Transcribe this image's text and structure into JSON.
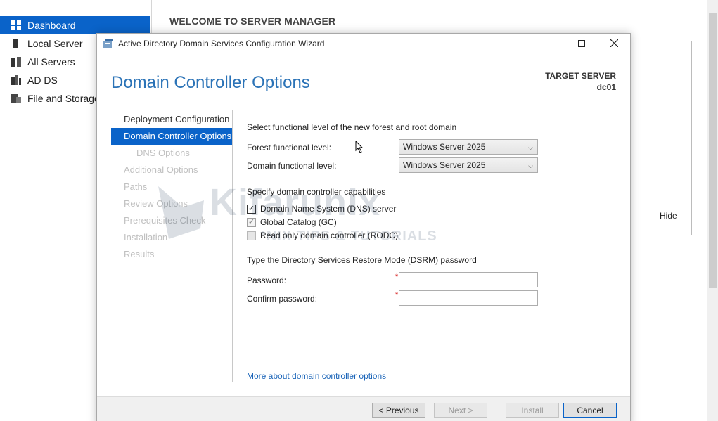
{
  "server_manager": {
    "welcome": "WELCOME TO SERVER MANAGER",
    "sidebar": [
      {
        "label": "Dashboard",
        "icon": "dashboard-icon",
        "active": true
      },
      {
        "label": "Local Server",
        "icon": "server-icon",
        "active": false
      },
      {
        "label": "All Servers",
        "icon": "servers-icon",
        "active": false
      },
      {
        "label": "AD DS",
        "icon": "adds-icon",
        "active": false
      },
      {
        "label": "File and Storage",
        "icon": "storage-icon",
        "active": false
      }
    ],
    "hide_label": "Hide"
  },
  "wizard": {
    "title": "Active Directory Domain Services Configuration Wizard",
    "page_heading": "Domain Controller Options",
    "target_label": "TARGET SERVER",
    "target_name": "dc01",
    "nav": [
      {
        "label": "Deployment Configuration",
        "state": "done"
      },
      {
        "label": "Domain Controller Options",
        "state": "active"
      },
      {
        "label": "DNS Options",
        "state": "pending",
        "sub": true
      },
      {
        "label": "Additional Options",
        "state": "pending"
      },
      {
        "label": "Paths",
        "state": "pending"
      },
      {
        "label": "Review Options",
        "state": "pending"
      },
      {
        "label": "Prerequisites Check",
        "state": "pending"
      },
      {
        "label": "Installation",
        "state": "pending"
      },
      {
        "label": "Results",
        "state": "pending"
      }
    ],
    "functional_heading": "Select functional level of the new forest and root domain",
    "forest_label": "Forest functional level:",
    "forest_value": "Windows Server 2025",
    "domain_label": "Domain functional level:",
    "domain_value": "Windows Server 2025",
    "capabilities_heading": "Specify domain controller capabilities",
    "capabilities": [
      {
        "label": "Domain Name System (DNS) server",
        "checked": true,
        "disabled": false
      },
      {
        "label": "Global Catalog (GC)",
        "checked": true,
        "disabled": true
      },
      {
        "label": "Read only domain controller (RODC)",
        "checked": false,
        "disabled": true
      }
    ],
    "dsrm_heading": "Type the Directory Services Restore Mode (DSRM) password",
    "password_label": "Password:",
    "confirm_label": "Confirm password:",
    "required_mark": "*",
    "more_link": "More about domain controller options",
    "buttons": {
      "previous": "< Previous",
      "next": "Next >",
      "install": "Install",
      "cancel": "Cancel"
    }
  },
  "watermark": {
    "brand": "Kifarunix",
    "tagline": "*NIX TIPS & TUTORIALS"
  },
  "colors": {
    "accent": "#0a63c9",
    "heading": "#2b73b7",
    "link": "#1a64b8",
    "required": "#d00000"
  }
}
